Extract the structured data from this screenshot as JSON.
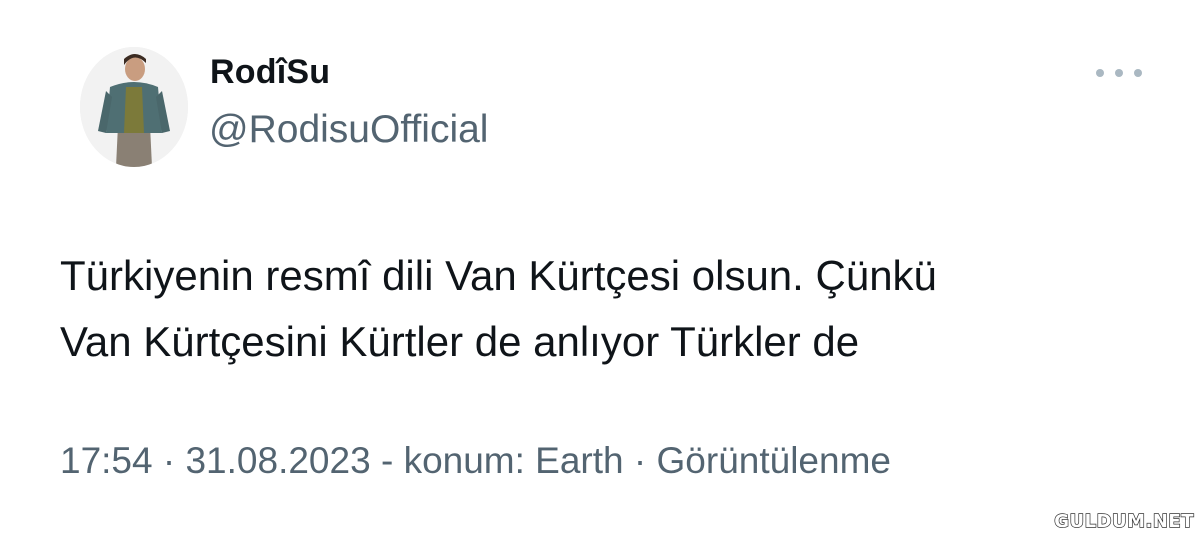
{
  "tweet": {
    "author": {
      "display_name": "RodîSu",
      "handle": "@RodisuOfficial"
    },
    "text_lines": [
      "Türkiyenin resmî dili Van Kürtçesi olsun. Çünkü",
      "Van Kürtçesini Kürtler de anlıyor Türkler de"
    ],
    "meta": {
      "time": "17:54",
      "sep1": " · ",
      "date": "31.08.2023",
      "sep2": " - ",
      "location": "konum: Earth",
      "sep3": " · ",
      "views_label": "Görüntülenme"
    },
    "more_icon": "more-horizontal-icon"
  },
  "watermark": "GULDUM.NET"
}
